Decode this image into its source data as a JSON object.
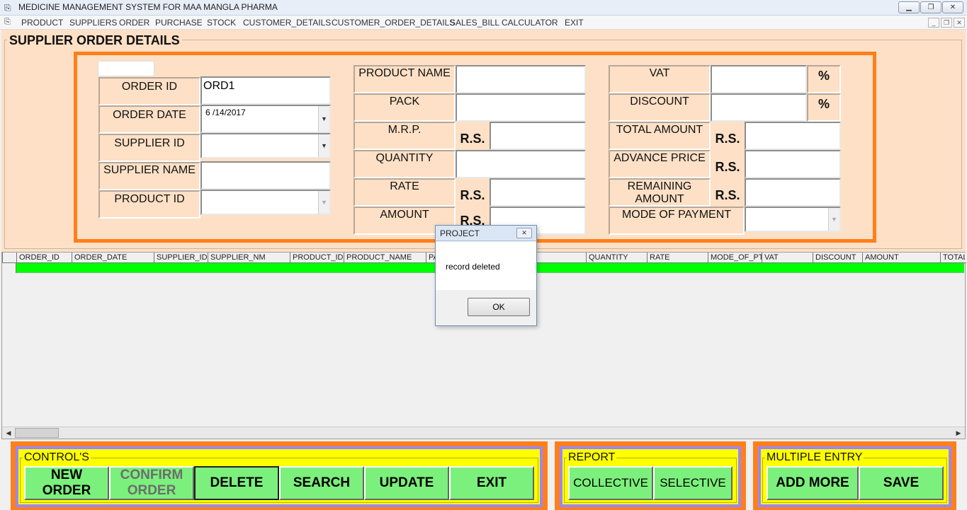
{
  "window": {
    "title": "MEDICINE MANAGEMENT SYSTEM FOR MAA MANGLA PHARMA",
    "minimize": "▁",
    "restore": "❐",
    "close": "✕"
  },
  "menu": {
    "items": [
      "PRODUCT",
      "SUPPLIERS",
      "ORDER",
      "PURCHASE",
      "STOCK",
      "CUSTOMER_DETAILS",
      "CUSTOMER_ORDER_DETAILS",
      "SALES_BILL",
      "CALCULATOR",
      "EXIT"
    ]
  },
  "form": {
    "title": "SUPPLIER ORDER DETAILS",
    "left": {
      "order_id_label": "ORDER ID",
      "order_id_value": "ORD1",
      "order_date_label": "ORDER DATE",
      "order_date_value": "6 /14/2017",
      "supplier_id_label": "SUPPLIER ID",
      "supplier_id_value": "",
      "supplier_name_label": "SUPPLIER NAME",
      "supplier_name_value": "",
      "product_id_label": "PRODUCT ID",
      "product_id_value": ""
    },
    "middle": {
      "product_name_label": "PRODUCT NAME",
      "pack_label": "PACK",
      "mrp_label": "M.R.P.",
      "quantity_label": "QUANTITY",
      "rate_label": "RATE",
      "amount_label": "AMOUNT",
      "currency": "R.S."
    },
    "right": {
      "vat_label": "VAT",
      "discount_label": "DISCOUNT",
      "percent": "%",
      "total_amount_label": "TOTAL AMOUNT",
      "advance_price_label": "ADVANCE PRICE",
      "remaining_amount_label": "REMAINING AMOUNT",
      "mode_of_payment_label": "MODE OF PAYMENT",
      "currency": "R.S."
    }
  },
  "grid": {
    "columns": [
      "ORDER_ID",
      "ORDER_DATE",
      "SUPPLIER_ID",
      "SUPPLIER_NM",
      "PRODUCT_ID",
      "PRODUCT_NAME",
      "PA",
      "QUANTITY",
      "RATE",
      "MODE_OF_PT",
      "VAT",
      "DISCOUNT",
      "AMOUNT",
      "TOTAL"
    ]
  },
  "panels": {
    "controls": {
      "title": "CONTROL'S",
      "new_order": "NEW ORDER",
      "confirm_order": "CONFIRM ORDER",
      "delete": "DELETE",
      "search": "SEARCH",
      "update": "UPDATE",
      "exit": "EXIT"
    },
    "report": {
      "title": "REPORT",
      "collective": "COLLECTIVE",
      "selective": "SELECTIVE"
    },
    "multiple": {
      "title": "MULTIPLE ENTRY",
      "add_more": "ADD MORE",
      "save": "SAVE"
    }
  },
  "dialog": {
    "title": "PROJECT",
    "message": "record deleted",
    "ok": "OK",
    "close": "✕"
  },
  "colors": {
    "form_bg": "#fde0c6",
    "accent_orange": "#ff7f1a",
    "panel_yellow": "#ffff00",
    "panel_purple": "#9a86ff",
    "button_green": "#7cf07c",
    "row_green": "#00ff00"
  }
}
